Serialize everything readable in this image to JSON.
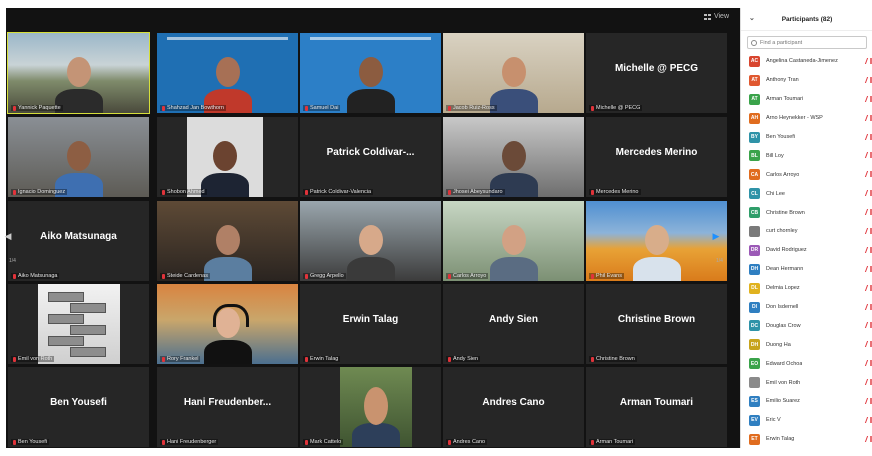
{
  "window": {
    "view_label": "View",
    "page_left": "1/4",
    "page_right": "1/4"
  },
  "tiles": [
    {
      "name": "Yannick Paquette",
      "display": "",
      "type": "video",
      "speaking": true
    },
    {
      "name": "Shahzad Jan Bowthorn",
      "display": "",
      "type": "video"
    },
    {
      "name": "Samuel Dai",
      "display": "",
      "type": "video"
    },
    {
      "name": "Jacob Ruiz-Ross",
      "display": "",
      "type": "video"
    },
    {
      "name": "Michelle @ PECG",
      "display": "Michelle @ PECG",
      "type": "name"
    },
    {
      "name": "Ignacio Dominguez",
      "display": "",
      "type": "video"
    },
    {
      "name": "Shobon Ahmed",
      "display": "",
      "type": "video"
    },
    {
      "name": "Patrick Coldivar-Valencia",
      "display": "Patrick Coldivar-...",
      "type": "name"
    },
    {
      "name": "Jhosei Abeysundaro",
      "display": "",
      "type": "video"
    },
    {
      "name": "Mercedes Merino",
      "display": "Mercedes Merino",
      "type": "name"
    },
    {
      "name": "Aiko Matsunaga",
      "display": "Aiko Matsunaga",
      "type": "name"
    },
    {
      "name": "Steide Cardenas",
      "display": "",
      "type": "video"
    },
    {
      "name": "Gregg Arpello",
      "display": "",
      "type": "video"
    },
    {
      "name": "Carlos Arroyo",
      "display": "",
      "type": "video"
    },
    {
      "name": "Phil Evans",
      "display": "",
      "type": "video"
    },
    {
      "name": "Emil von Roth",
      "display": "",
      "type": "video"
    },
    {
      "name": "Rory Frankel",
      "display": "",
      "type": "video"
    },
    {
      "name": "Erwin Talag",
      "display": "Erwin Talag",
      "type": "name"
    },
    {
      "name": "Andy Sien",
      "display": "Andy Sien",
      "type": "name"
    },
    {
      "name": "Christine Brown",
      "display": "Christine Brown",
      "type": "name"
    },
    {
      "name": "Ben Yousefi",
      "display": "Ben Yousefi",
      "type": "name"
    },
    {
      "name": "Hani Freudenberger",
      "display": "Hani Freudenber...",
      "type": "name"
    },
    {
      "name": "Mark Cattelo",
      "display": "",
      "type": "video"
    },
    {
      "name": "Andres Cano",
      "display": "Andres Cano",
      "type": "name"
    },
    {
      "name": "Arman Toumari",
      "display": "Arman Toumari",
      "type": "name"
    }
  ],
  "panel": {
    "title": "Participants (82)",
    "search_placeholder": "Find a participant",
    "participants": [
      {
        "initials": "AC",
        "name": "Angelina Castaneda-Jimenez",
        "color": "#d8452e"
      },
      {
        "initials": "AT",
        "name": "Anthony Tran",
        "color": "#e0582f"
      },
      {
        "initials": "AT",
        "name": "Arman Toumari",
        "color": "#3aa34a"
      },
      {
        "initials": "AH",
        "name": "Arno Heynekker - WSP",
        "color": "#e06c1f"
      },
      {
        "initials": "BY",
        "name": "Ben Yousefi",
        "color": "#2f93a8"
      },
      {
        "initials": "BL",
        "name": "Bill Loy",
        "color": "#3aa34a"
      },
      {
        "initials": "CA",
        "name": "Carlos Arroyo",
        "color": "#e06c1f"
      },
      {
        "initials": "CL",
        "name": "Chi Lee",
        "color": "#2f93a8"
      },
      {
        "initials": "CB",
        "name": "Christine Brown",
        "color": "#2f9e6a"
      },
      {
        "initials": "",
        "name": "curt chornley",
        "color": "#7a7a7a"
      },
      {
        "initials": "DR",
        "name": "David Rodriguez",
        "color": "#9b59b6"
      },
      {
        "initials": "DH",
        "name": "Dean Hermann",
        "color": "#2f7fc1"
      },
      {
        "initials": "DL",
        "name": "Delmia Lopez",
        "color": "#e0b21f"
      },
      {
        "initials": "DI",
        "name": "Don Isdernell",
        "color": "#2f7fc1"
      },
      {
        "initials": "DC",
        "name": "Douglas Crow",
        "color": "#2f93a8"
      },
      {
        "initials": "DH",
        "name": "Duong Ha",
        "color": "#c7a41d"
      },
      {
        "initials": "EO",
        "name": "Edward Ochoa",
        "color": "#3aa34a"
      },
      {
        "initials": "",
        "name": "Emil von Roth",
        "color": "#8a8a8a"
      },
      {
        "initials": "ES",
        "name": "Emilio Suarez",
        "color": "#2f7fc1"
      },
      {
        "initials": "EV",
        "name": "Eric V",
        "color": "#2f7fc1"
      },
      {
        "initials": "ET",
        "name": "Erwin Talag",
        "color": "#e06c1f"
      }
    ]
  }
}
